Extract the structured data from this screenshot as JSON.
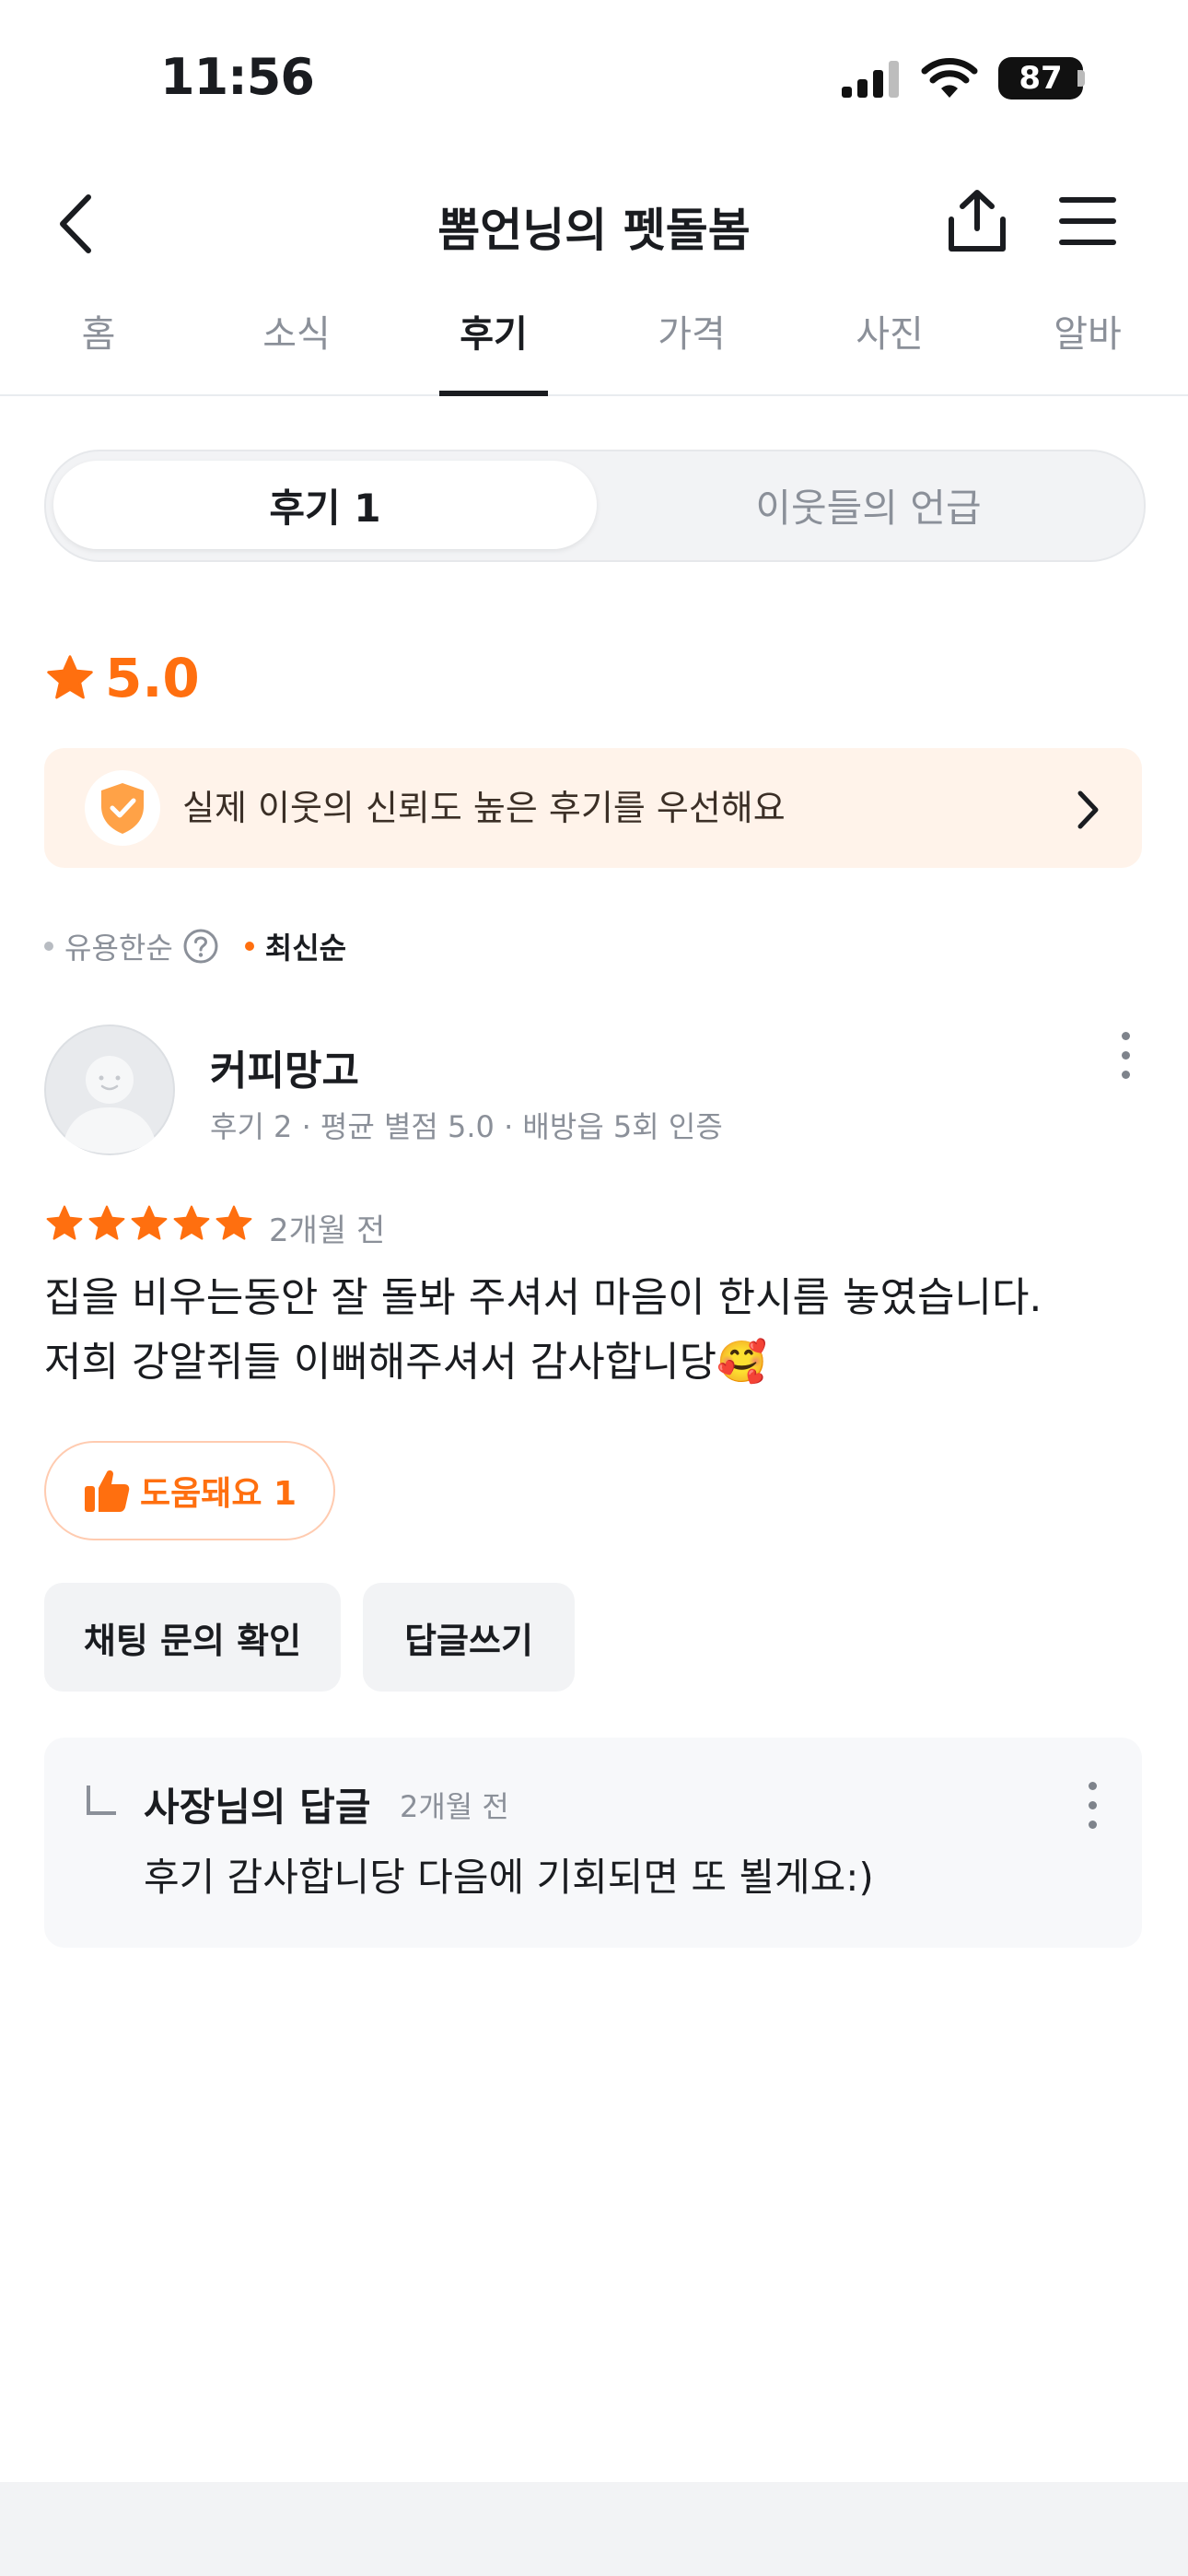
{
  "status_bar": {
    "time": "11:56",
    "battery": "87"
  },
  "header": {
    "title": "뽐언닝의 펫돌봄"
  },
  "tabs": [
    {
      "label": "홈"
    },
    {
      "label": "소식"
    },
    {
      "label": "후기"
    },
    {
      "label": "가격"
    },
    {
      "label": "사진"
    },
    {
      "label": "알바"
    }
  ],
  "active_tab": "후기",
  "segment": {
    "reviews_label": "후기 1",
    "mentions_label": "이웃들의 언급"
  },
  "rating": {
    "value": "5.0"
  },
  "banner": {
    "text": "실제 이웃의 신뢰도 높은 후기를 우선해요"
  },
  "sort": {
    "helpful": "유용한순",
    "latest": "최신순"
  },
  "review": {
    "username": "커피망고",
    "stats": "후기 2 · 평균 별점 5.0 · 배방읍 5회 인증",
    "stars": 5,
    "date": "2개월 전",
    "text_line1": "집을 비우는동안 잘 돌봐 주셔서 마음이 한시름 놓였습니다.",
    "text_line2": "저희 강알쥐들 이뻐해주셔서 감사합니당🥰",
    "helpful_label": "도움돼요 1",
    "chat_button": "채팅 문의 확인",
    "reply_button": "답글쓰기"
  },
  "owner_reply": {
    "title": "사장님의 답글",
    "date": "2개월 전",
    "text": "후기 감사합니당 다음에 기회되면 또 뵐게요:)"
  },
  "colors": {
    "accent": "#ff6f0f",
    "banner_bg": "#fff3ea",
    "muted": "#8b9099"
  }
}
